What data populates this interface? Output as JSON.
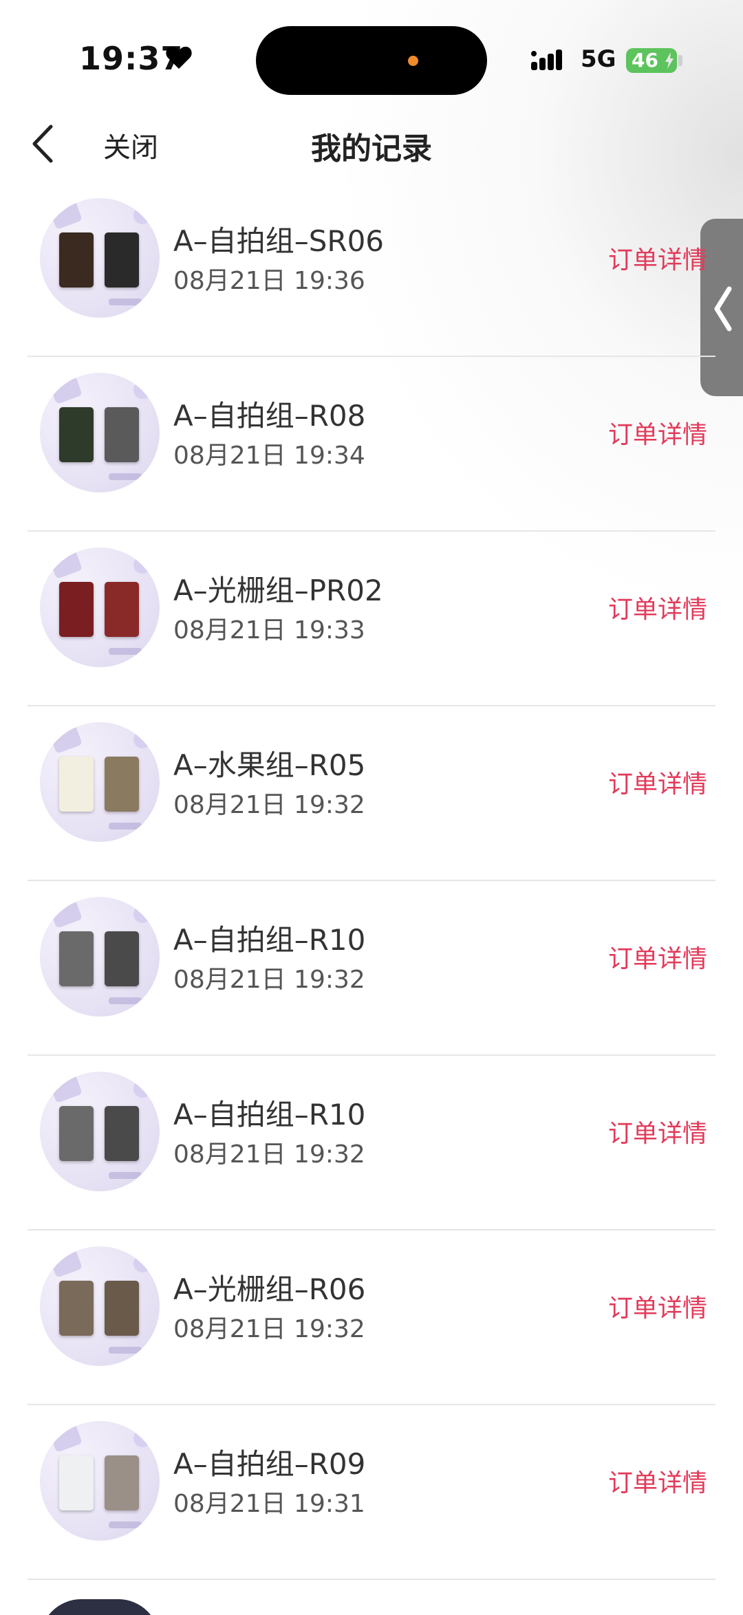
{
  "status_bar": {
    "time": "19:37",
    "network": "5G",
    "battery": "46"
  },
  "header": {
    "close_label": "关闭",
    "title": "我的记录"
  },
  "colors": {
    "accent": "#e23a5a",
    "battery": "#5dc35d"
  },
  "records": [
    {
      "title": "A–自拍组–SR06",
      "time": "08月21日 19:36",
      "action": "订单详情",
      "card_left": "#3a2a20",
      "card_right": "#2a2a2a"
    },
    {
      "title": "A–自拍组–R08",
      "time": "08月21日 19:34",
      "action": "订单详情",
      "card_left": "#2f3b2a",
      "card_right": "#5a5a5a"
    },
    {
      "title": "A–光栅组–PR02",
      "time": "08月21日 19:33",
      "action": "订单详情",
      "card_left": "#7a1e22",
      "card_right": "#8a2a28"
    },
    {
      "title": "A–水果组–R05",
      "time": "08月21日 19:32",
      "action": "订单详情",
      "card_left": "#f3efe0",
      "card_right": "#8a7a60"
    },
    {
      "title": "A–自拍组–R10",
      "time": "08月21日 19:32",
      "action": "订单详情",
      "card_left": "#6a6a6a",
      "card_right": "#4a4a4a"
    },
    {
      "title": "A–自拍组–R10",
      "time": "08月21日 19:32",
      "action": "订单详情",
      "card_left": "#6a6a6a",
      "card_right": "#4a4a4a"
    },
    {
      "title": "A–光栅组–R06",
      "time": "08月21日 19:32",
      "action": "订单详情",
      "card_left": "#7a6a5a",
      "card_right": "#6a5a4a"
    },
    {
      "title": "A–自拍组–R09",
      "time": "08月21日 19:31",
      "action": "订单详情",
      "card_left": "#eef0f2",
      "card_right": "#9a9088"
    }
  ]
}
